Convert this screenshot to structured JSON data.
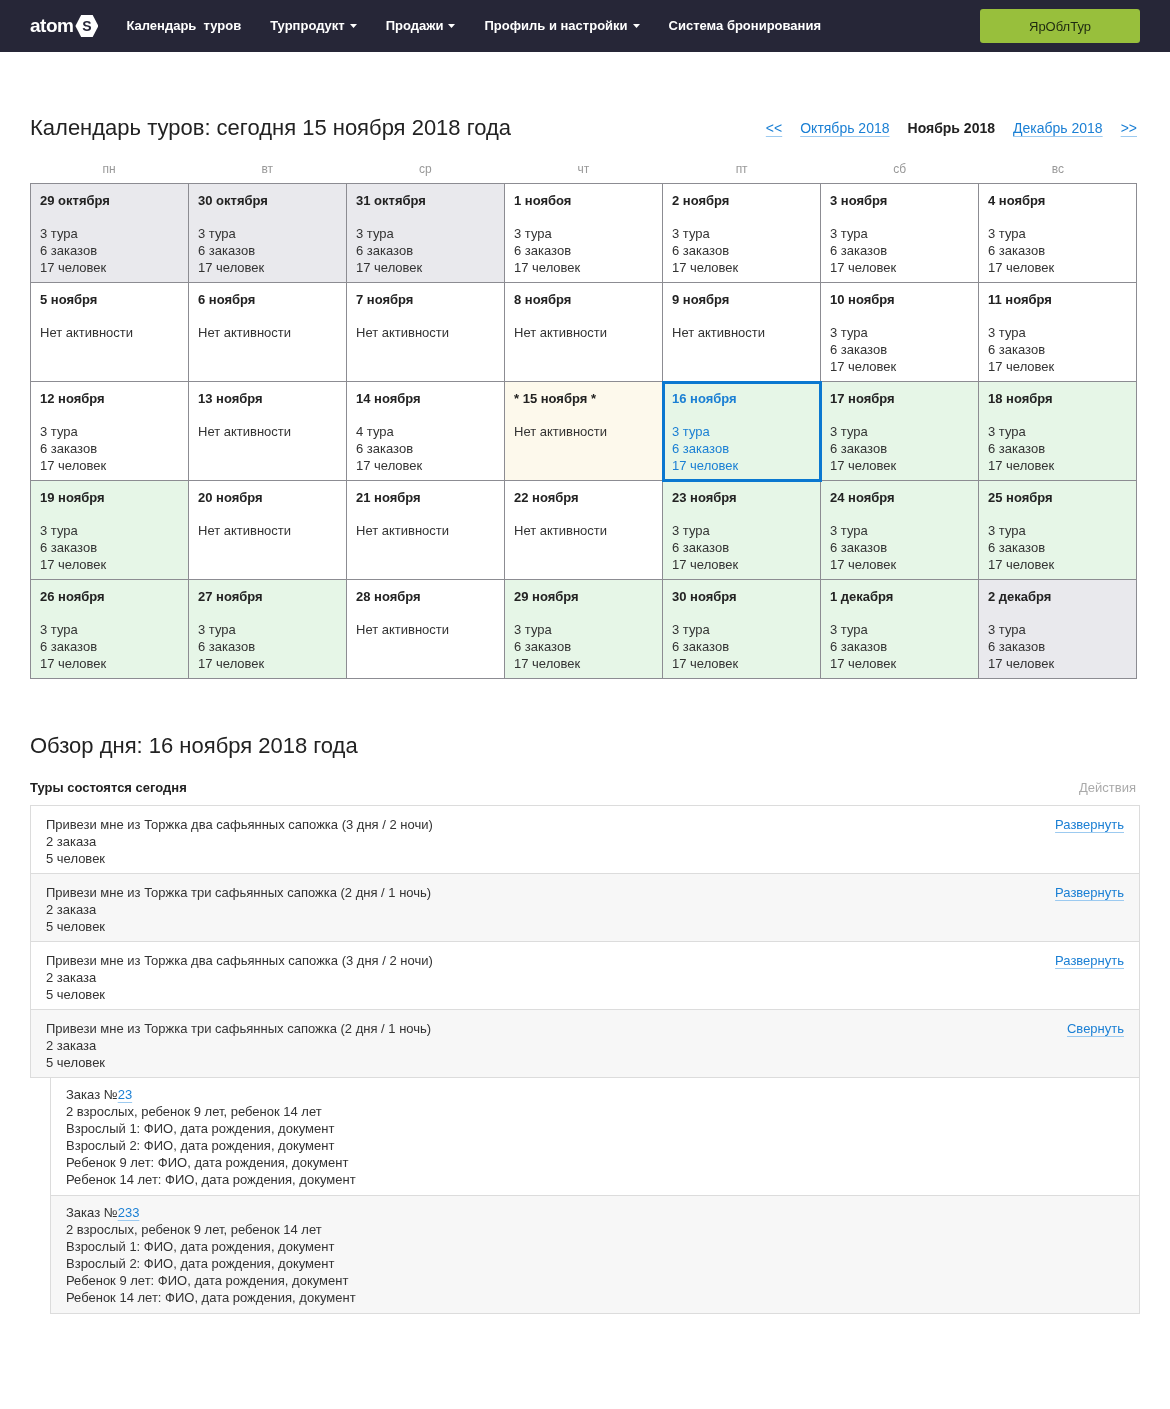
{
  "nav": {
    "logo": {
      "text": "atom",
      "badge": "S"
    },
    "items": [
      {
        "label": "Календарь  туров",
        "has_menu": false
      },
      {
        "label": "Турпродукт",
        "has_menu": true
      },
      {
        "label": "Продажи",
        "has_menu": true
      },
      {
        "label": "Профиль и настройки",
        "has_menu": true
      },
      {
        "label": "Система бронирования",
        "has_menu": false
      }
    ],
    "account_button": "ЯрОблТур"
  },
  "calendar": {
    "title": "Календарь туров: сегодня 15 ноября 2018 года",
    "month_nav": [
      {
        "label": "<<",
        "selected": false
      },
      {
        "label": "Октябрь 2018",
        "selected": false
      },
      {
        "label": "Ноябрь 2018",
        "selected": true
      },
      {
        "label": "Декабрь 2018",
        "selected": false
      },
      {
        "label": ">>",
        "selected": false
      }
    ],
    "weekdays": [
      "пн",
      "вт",
      "ср",
      "чт",
      "пт",
      "сб",
      "вс"
    ],
    "days": [
      {
        "date": "29 октября",
        "color": "#e9e9ed",
        "selected": false,
        "lines": [
          "3 тура",
          "6 заказов",
          "17 человек"
        ]
      },
      {
        "date": "30 октября",
        "color": "#e9e9ed",
        "selected": false,
        "lines": [
          "3 тура",
          "6 заказов",
          "17 человек"
        ]
      },
      {
        "date": "31 октября",
        "color": "#e9e9ed",
        "selected": false,
        "lines": [
          "3 тура",
          "6 заказов",
          "17 человек"
        ]
      },
      {
        "date": "1 ноябоя",
        "color": "#ffffff",
        "selected": false,
        "lines": [
          "3 тура",
          "6 заказов",
          "17 человек"
        ]
      },
      {
        "date": "2 ноября",
        "color": "#ffffff",
        "selected": false,
        "lines": [
          "3 тура",
          "6 заказов",
          "17 человек"
        ]
      },
      {
        "date": "3 ноября",
        "color": "#ffffff",
        "selected": false,
        "lines": [
          "3 тура",
          "6 заказов",
          "17 человек"
        ]
      },
      {
        "date": "4 ноября",
        "color": "#ffffff",
        "selected": false,
        "lines": [
          "3 тура",
          "6 заказов",
          "17 человек"
        ]
      },
      {
        "date": "5 ноября",
        "color": "#ffffff",
        "selected": false,
        "lines": [
          "Нет активности"
        ]
      },
      {
        "date": "6 ноября",
        "color": "#ffffff",
        "selected": false,
        "lines": [
          "Нет активности"
        ]
      },
      {
        "date": "7 ноября",
        "color": "#ffffff",
        "selected": false,
        "lines": [
          "Нет активности"
        ]
      },
      {
        "date": "8 ноября",
        "color": "#ffffff",
        "selected": false,
        "lines": [
          "Нет активности"
        ]
      },
      {
        "date": "9 ноября",
        "color": "#ffffff",
        "selected": false,
        "lines": [
          "Нет активности"
        ]
      },
      {
        "date": "10 ноября",
        "color": "#ffffff",
        "selected": false,
        "lines": [
          "3 тура",
          "6 заказов",
          "17 человек"
        ]
      },
      {
        "date": "11 ноября",
        "color": "#ffffff",
        "selected": false,
        "lines": [
          "3 тура",
          "6 заказов",
          "17 человек"
        ]
      },
      {
        "date": "12 ноября",
        "color": "#ffffff",
        "selected": false,
        "lines": [
          "3 тура",
          "6 заказов",
          "17 человек"
        ]
      },
      {
        "date": "13 ноября",
        "color": "#ffffff",
        "selected": false,
        "lines": [
          "Нет активности"
        ]
      },
      {
        "date": "14 ноября",
        "color": "#ffffff",
        "selected": false,
        "lines": [
          "4 тура",
          "6 заказов",
          "17 человек"
        ]
      },
      {
        "date": "* 15 ноября *",
        "color": "#fdf9ec",
        "selected": false,
        "lines": [
          "Нет активности"
        ]
      },
      {
        "date": "16 ноября",
        "color": "#e6f6e7",
        "selected": true,
        "lines": [
          "3 тура",
          "6 заказов",
          "17 человек"
        ]
      },
      {
        "date": "17 ноября",
        "color": "#e6f6e7",
        "selected": false,
        "lines": [
          "3 тура",
          "6 заказов",
          "17 человек"
        ]
      },
      {
        "date": "18 ноября",
        "color": "#e6f6e7",
        "selected": false,
        "lines": [
          "3 тура",
          "6 заказов",
          "17 человек"
        ]
      },
      {
        "date": "19 ноября",
        "color": "#e6f6e7",
        "selected": false,
        "lines": [
          "3 тура",
          "6 заказов",
          "17 человек"
        ]
      },
      {
        "date": "20 ноября",
        "color": "#ffffff",
        "selected": false,
        "lines": [
          "Нет активности"
        ]
      },
      {
        "date": "21 ноября",
        "color": "#ffffff",
        "selected": false,
        "lines": [
          "Нет активности"
        ]
      },
      {
        "date": "22 ноября",
        "color": "#ffffff",
        "selected": false,
        "lines": [
          "Нет активности"
        ]
      },
      {
        "date": "23 ноября",
        "color": "#e6f6e7",
        "selected": false,
        "lines": [
          "3 тура",
          "6 заказов",
          "17 человек"
        ]
      },
      {
        "date": "24 ноября",
        "color": "#e6f6e7",
        "selected": false,
        "lines": [
          "3 тура",
          "6 заказов",
          "17 человек"
        ]
      },
      {
        "date": "25 ноября",
        "color": "#e6f6e7",
        "selected": false,
        "lines": [
          "3 тура",
          "6 заказов",
          "17 человек"
        ]
      },
      {
        "date": "26 ноября",
        "color": "#e6f6e7",
        "selected": false,
        "lines": [
          "3 тура",
          "6 заказов",
          "17 человек"
        ]
      },
      {
        "date": "27 ноября",
        "color": "#e6f6e7",
        "selected": false,
        "lines": [
          "3 тура",
          "6 заказов",
          "17 человек"
        ]
      },
      {
        "date": "28 ноября",
        "color": "#ffffff",
        "selected": false,
        "lines": [
          "Нет активности"
        ]
      },
      {
        "date": "29 ноября",
        "color": "#e6f6e7",
        "selected": false,
        "lines": [
          "3 тура",
          "6 заказов",
          "17 человек"
        ]
      },
      {
        "date": "30 ноября",
        "color": "#e6f6e7",
        "selected": false,
        "lines": [
          "3 тура",
          "6 заказов",
          "17 человек"
        ]
      },
      {
        "date": "1 декабря",
        "color": "#e6f6e7",
        "selected": false,
        "lines": [
          "3 тура",
          "6 заказов",
          "17 человек"
        ]
      },
      {
        "date": "2 декабря",
        "color": "#e9e9ed",
        "selected": false,
        "lines": [
          "3 тура",
          "6 заказов",
          "17 человек"
        ]
      }
    ]
  },
  "day_overview": {
    "title": "Обзор дня: 16 ноября 2018 года",
    "table_title": "Туры состоятся сегодня",
    "actions_heading": "Действия",
    "tours": [
      {
        "title": "Привези мне из Торжка два сафьянных сапожка (3 дня / 2 ночи)",
        "orders": "2 заказа",
        "people": "5 человек",
        "action": "Развернуть"
      },
      {
        "title": "Привези мне из Торжка три сафьянных сапожка (2 дня / 1 ночь)",
        "orders": "2 заказа",
        "people": "5 человек",
        "action": "Развернуть"
      },
      {
        "title": "Привези мне из Торжка два сафьянных сапожка (3 дня / 2 ночи)",
        "orders": "2 заказа",
        "people": "5 человек",
        "action": "Развернуть"
      },
      {
        "title": "Привези мне из Торжка три сафьянных сапожка (2 дня / 1 ночь)",
        "orders": "2 заказа",
        "people": "5 человек",
        "action": "Свернуть",
        "order_list": [
          {
            "prefix": "Заказ №",
            "number": "23",
            "lines": [
              "2 взрослых, ребенок 9 лет, ребенок 14 лет",
              "Взрослый 1: ФИО, дата рождения, документ",
              "Взрослый 2: ФИО, дата рождения, документ",
              "Ребенок 9 лет: ФИО, дата рождения, документ",
              "Ребенок 14 лет: ФИО, дата рождения, документ"
            ]
          },
          {
            "prefix": "Заказ №",
            "number": "233",
            "lines": [
              "2 взрослых, ребенок 9 лет, ребенок 14 лет",
              "Взрослый 1: ФИО, дата рождения, документ",
              "Взрослый 2: ФИО, дата рождения, документ",
              "Ребенок 9 лет: ФИО, дата рождения, документ",
              "Ребенок 14 лет: ФИО, дата рождения, документ"
            ]
          }
        ]
      }
    ]
  }
}
